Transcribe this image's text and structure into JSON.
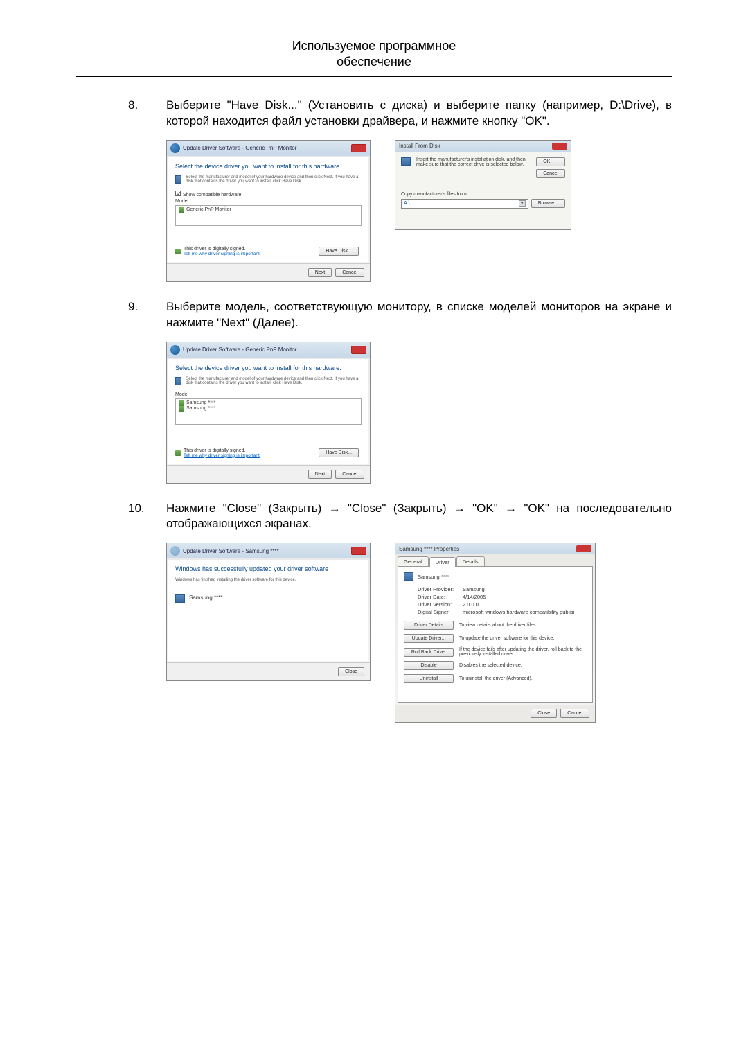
{
  "header": {
    "line1": "Используемое программное",
    "line2": "обеспечение"
  },
  "steps": [
    {
      "number": "8.",
      "text": "Выберите \"Have Disk...\" (Установить с диска) и выберите папку (например, D:\\Drive), в которой находится файл установки драйвера, и нажмите кнопку \"OK\"."
    },
    {
      "number": "9.",
      "text": "Выберите модель, соответствующую монитору, в списке моделей мониторов на экране и нажмите \"Next\" (Далее)."
    },
    {
      "number": "10.",
      "text": "Нажмите \"Close\" (Закрыть) → \"Close\" (Закрыть) → \"OK\" → \"OK\" на последовательно отображающихся экранах."
    }
  ],
  "wizard": {
    "title": "Update Driver Software - Generic PnP Monitor",
    "heading": "Select the device driver you want to install for this hardware.",
    "subtext": "Select the manufacturer and model of your hardware device and then click Next. If you have a disk that contains the driver you want to install, click Have Disk.",
    "show_compatible": "Show compatible hardware",
    "model_label": "Model",
    "model_item": "Generic PnP Monitor",
    "signed": "This driver is digitally signed.",
    "tell_why": "Tell me why driver signing is important",
    "have_disk": "Have Disk...",
    "next": "Next",
    "cancel": "Cancel",
    "samsung_item_1": "Samsung ****",
    "samsung_item_2": "Samsung ****"
  },
  "install_dialog": {
    "title": "Install From Disk",
    "text": "Insert the manufacturer's installation disk, and then make sure that the correct drive is selected below.",
    "ok": "OK",
    "cancel": "Cancel",
    "copy_label": "Copy manufacturer's files from:",
    "combo_value": "A:\\",
    "browse": "Browse..."
  },
  "success_wizard": {
    "title": "Update Driver Software - Samsung ****",
    "heading": "Windows has successfully updated your driver software",
    "subtext": "Windows has finished installing the driver software for this device.",
    "item": "Samsung ****",
    "close": "Close"
  },
  "properties": {
    "title": "Samsung **** Properties",
    "tab_general": "General",
    "tab_driver": "Driver",
    "tab_details": "Details",
    "device_name": "Samsung ****",
    "rows": {
      "provider_label": "Driver Provider:",
      "provider_value": "Samsung",
      "date_label": "Driver Date:",
      "date_value": "4/14/2005",
      "version_label": "Driver Version:",
      "version_value": "2.0.0.0",
      "signer_label": "Digital Signer:",
      "signer_value": "microsoft windows hardware compatibility publisi"
    },
    "actions": {
      "details_btn": "Driver Details",
      "details_desc": "To view details about the driver files.",
      "update_btn": "Update Driver...",
      "update_desc": "To update the driver software for this device.",
      "rollback_btn": "Roll Back Driver",
      "rollback_desc": "If the device fails after updating the driver, roll back to the previously installed driver.",
      "disable_btn": "Disable",
      "disable_desc": "Disables the selected device.",
      "uninstall_btn": "Uninstall",
      "uninstall_desc": "To uninstall the driver (Advanced)."
    },
    "close": "Close",
    "cancel": "Cancel"
  }
}
